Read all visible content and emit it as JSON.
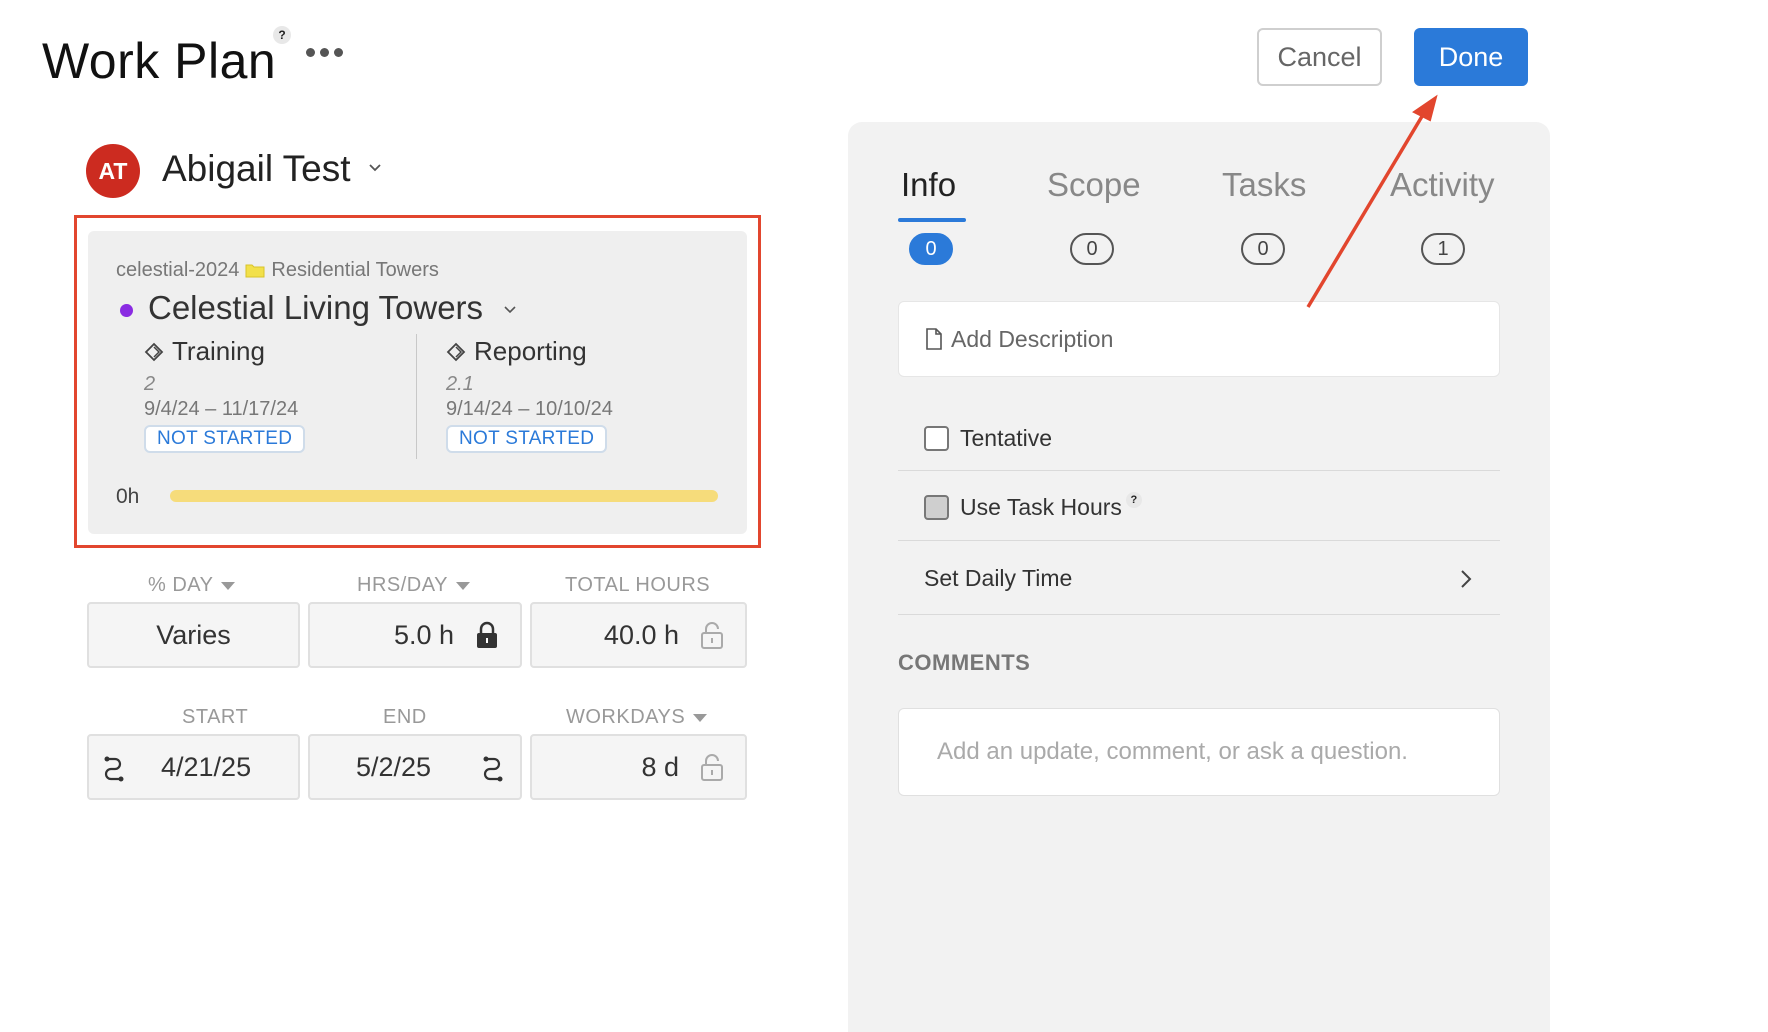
{
  "header": {
    "title": "Work Plan",
    "help": "?",
    "cancel_label": "Cancel",
    "done_label": "Done"
  },
  "member": {
    "initials": "AT",
    "name": "Abigail Test",
    "avatar_color": "#cc2b20"
  },
  "work_card": {
    "project_code": "celestial-2024",
    "folder": "Residential Towers",
    "project_name": "Celestial Living Towers",
    "project_color": "#8a2be2",
    "phases": [
      {
        "name": "Training",
        "number": "2",
        "dates": "9/4/24 – 11/17/24",
        "status": "NOT STARTED"
      },
      {
        "name": "Reporting",
        "number": "2.1",
        "dates": "9/14/24 – 10/10/24",
        "status": "NOT STARTED"
      }
    ],
    "hours": "0h"
  },
  "fields": {
    "pct_day_label": "% DAY",
    "hrs_day_label": "HRS/DAY",
    "total_hours_label": "TOTAL HOURS",
    "pct_day_value": "Varies",
    "hrs_day_value": "5.0 h",
    "total_hours_value": "40.0 h",
    "start_label": "START",
    "end_label": "END",
    "workdays_label": "WORKDAYS",
    "start_value": "4/21/25",
    "end_value": "5/2/25",
    "workdays_value": "8 d"
  },
  "panel": {
    "tabs": [
      {
        "label": "Info",
        "count": "0"
      },
      {
        "label": "Scope",
        "count": "0"
      },
      {
        "label": "Tasks",
        "count": "0"
      },
      {
        "label": "Activity",
        "count": "1"
      }
    ],
    "description_placeholder": "Add Description",
    "tentative_label": "Tentative",
    "use_task_hours_label": "Use Task Hours",
    "help": "?",
    "daily_time_label": "Set Daily Time",
    "comments_heading": "COMMENTS",
    "comment_placeholder": "Add an update, comment, or ask a question."
  },
  "colors": {
    "accent": "#2b7ad9",
    "highlight": "#e2462e",
    "progress": "#f6dc7b"
  }
}
